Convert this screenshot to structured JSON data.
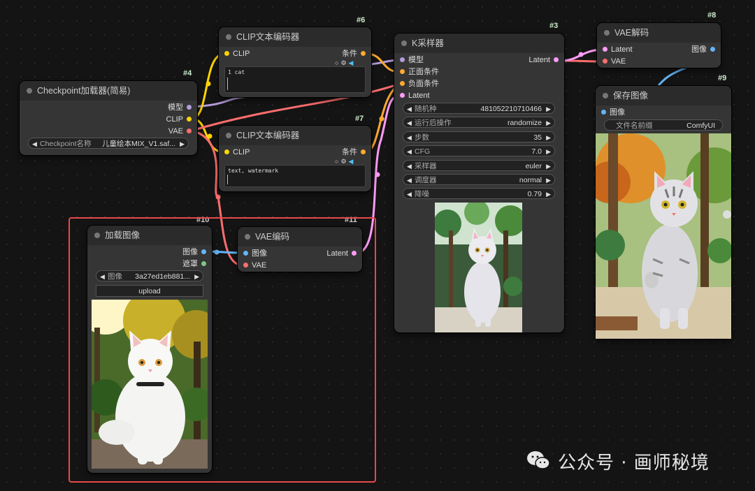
{
  "colors": {
    "model": "#b39ddb",
    "clip": "#ffd500",
    "vae": "#ff6e6e",
    "conditioning": "#ffa931",
    "latent": "#ff9cf9",
    "image": "#64b5f6",
    "mask": "#81c784",
    "highlight": "#e8494b"
  },
  "checkpoint_node": {
    "id": "#4",
    "title": "Checkpoint加载器(简易)",
    "outputs": [
      "模型",
      "CLIP",
      "VAE"
    ],
    "ckpt_label": "Checkpoint名称",
    "ckpt_value": "儿童绘本MIX_V1.saf..."
  },
  "clip_pos_node": {
    "id": "#6",
    "title": "CLIP文本编码器",
    "input": "CLIP",
    "output": "条件",
    "text": "1 cat"
  },
  "clip_neg_node": {
    "id": "#7",
    "title": "CLIP文本编码器",
    "input": "CLIP",
    "output": "条件",
    "text": "text, watermark"
  },
  "ksampler_node": {
    "id": "#3",
    "title": "K采样器",
    "inputs": [
      "模型",
      "正面条件",
      "负面条件",
      "Latent"
    ],
    "output": "Latent",
    "widgets": [
      {
        "label": "随机种",
        "value": "481052210710466"
      },
      {
        "label": "运行后操作",
        "value": "randomize"
      },
      {
        "label": "步数",
        "value": "35"
      },
      {
        "label": "CFG",
        "value": "7.0"
      },
      {
        "label": "采样器",
        "value": "euler"
      },
      {
        "label": "调度器",
        "value": "normal"
      },
      {
        "label": "降噪",
        "value": "0.79"
      }
    ]
  },
  "vae_decode_node": {
    "id": "#8",
    "title": "VAE解码",
    "inputs": [
      "Latent",
      "VAE"
    ],
    "output": "图像"
  },
  "save_image_node": {
    "id": "#9",
    "title": "保存图像",
    "input": "图像",
    "prefix_label": "文件名前缀",
    "prefix_value": "ComfyUI"
  },
  "load_image_node": {
    "id": "#10",
    "title": "加载图像",
    "outputs": [
      "图像",
      "遮罩"
    ],
    "image_label": "图像",
    "image_value": "3a27ed1eb881...",
    "upload_label": "upload"
  },
  "vae_encode_node": {
    "id": "#11",
    "title": "VAE编码",
    "inputs": [
      "图像",
      "VAE"
    ],
    "output": "Latent"
  },
  "watermark": {
    "text": "公众号 · 画师秘境"
  }
}
